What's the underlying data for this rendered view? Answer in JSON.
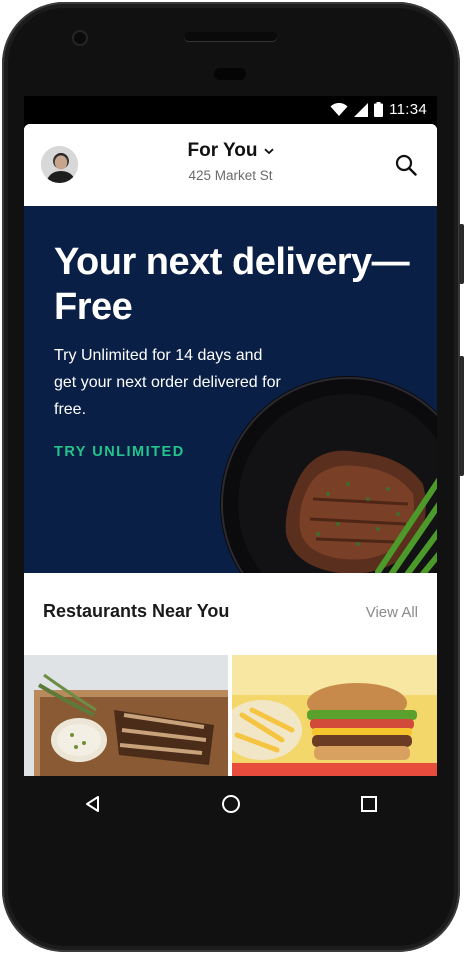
{
  "status_bar": {
    "time": "11:34"
  },
  "header": {
    "title": "For You",
    "subtitle": "425 Market St",
    "avatar_icon": "user-avatar",
    "search_icon": "search-icon",
    "chevron_icon": "chevron-down-icon"
  },
  "hero": {
    "headline": "Your next delivery—Free",
    "body": "Try Unlimited for 14 days and get your next order delivered for free.",
    "cta": "TRY UNLIMITED",
    "background_color": "#0a1f45",
    "cta_color": "#22c58b"
  },
  "section": {
    "title": "Restaurants Near You",
    "view_all": "View All"
  },
  "restaurants": [
    {
      "image": "grilled-dish-with-dip"
    },
    {
      "image": "burger-and-fries"
    }
  ],
  "nav": {
    "back_icon": "back-triangle-icon",
    "home_icon": "home-circle-icon",
    "recents_icon": "recents-square-icon"
  }
}
